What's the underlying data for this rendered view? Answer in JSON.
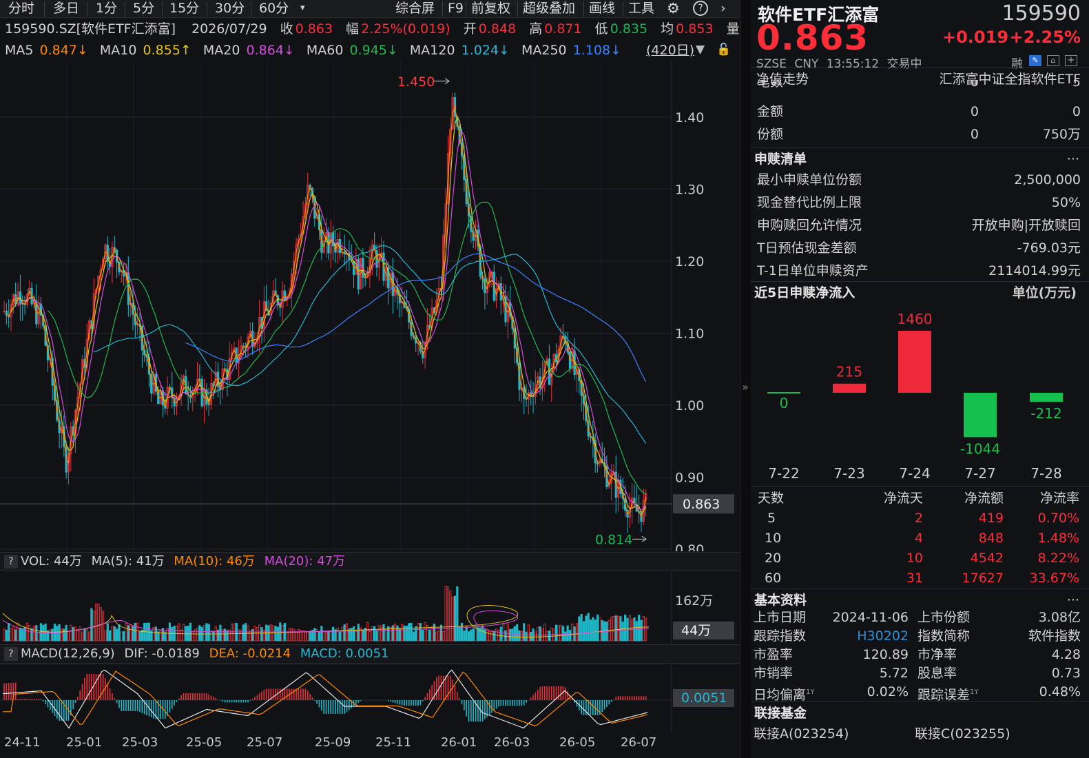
{
  "toolbar": {
    "periods": [
      "分时",
      "多日",
      "1分",
      "5分",
      "15分",
      "30分",
      "60分"
    ],
    "right": [
      "综合屏",
      "F9",
      "前复权",
      "超级叠加",
      "画线",
      "工具"
    ]
  },
  "quote": {
    "code": "159590.SZ[软件ETF汇添富]",
    "date": "2026/07/29",
    "close_label": "收",
    "close": "0.863",
    "change_label": "幅",
    "change": "2.25%(0.019)",
    "open_label": "开",
    "open": "0.848",
    "high_label": "高",
    "high": "0.871",
    "low_label": "低",
    "low": "0.835",
    "avg_label": "均",
    "avg": "0.853",
    "vol_tag": "量"
  },
  "ma": [
    {
      "label": "MA5",
      "value": "0.847↓",
      "color": "#ff8a00"
    },
    {
      "label": "MA10",
      "value": "0.855↑",
      "color": "#e3c21c"
    },
    {
      "label": "MA20",
      "value": "0.864↓",
      "color": "#d44ddb"
    },
    {
      "label": "MA60",
      "value": "0.945↓",
      "color": "#21b94e"
    },
    {
      "label": "MA120",
      "value": "1.024↓",
      "color": "#27b7d3"
    },
    {
      "label": "MA250",
      "value": "1.108↓",
      "color": "#3c83ff"
    }
  ],
  "period_range": "(420日)",
  "price_axis": {
    "ticks": [
      "1.40",
      "1.30",
      "1.20",
      "1.10",
      "1.00",
      "0.90",
      "0.80"
    ],
    "current": "0.863",
    "max_mark": "1.450",
    "min_mark": "0.814"
  },
  "volume": {
    "vol_label": "VOL: 44万",
    "ma5": "MA(5): 41万",
    "ma10": "MA(10): 46万",
    "ma20": "MA(20): 47万",
    "axis_top": "162万",
    "current": "44万"
  },
  "macd": {
    "label": "MACD(12,26,9)",
    "dif": "DIF: -0.0189",
    "dea": "DEA: -0.0214",
    "macd": "MACD: 0.0051",
    "current": "0.0051"
  },
  "x_axis": [
    "24-11",
    "25-01",
    "25-03",
    "25-05",
    "25-07",
    "25-09",
    "25-11",
    "26-01",
    "26-03",
    "26-05",
    "26-07"
  ],
  "header": {
    "name": "软件ETF汇添富",
    "code": "159590",
    "price": "0.863",
    "change": "+0.019",
    "change_pct": "+2.25%",
    "exchange": "SZSE",
    "currency": "CNY",
    "time": "13:55:12",
    "status": "交易中",
    "margin_tag": "融"
  },
  "nav": {
    "label": "净值走势",
    "index_name": "汇添富中证全指软件ETF"
  },
  "stats": [
    {
      "label": "笔数",
      "a": "0",
      "b": "5"
    },
    {
      "label": "金额",
      "a": "0",
      "b": "0"
    },
    {
      "label": "份额",
      "a": "0",
      "b": "750万"
    }
  ],
  "creation": {
    "title": "申赎清单",
    "more": "···",
    "rows": [
      {
        "label": "最小申赎单位份额",
        "value": "2,500,000"
      },
      {
        "label": "现金替代比例上限",
        "value": "50%"
      },
      {
        "label": "申购赎回允许情况",
        "value": "开放申购|开放赎回"
      },
      {
        "label": "T日预估现金差额",
        "value": "-769.03元"
      },
      {
        "label": "T-1日单位申赎资产",
        "value": "2114014.99元"
      }
    ]
  },
  "flow": {
    "title": "近5日申赎净流入",
    "unit": "单位(万元)",
    "bars": [
      {
        "date": "7-22",
        "value": 0,
        "label": "0"
      },
      {
        "date": "7-23",
        "value": 215,
        "label": "215"
      },
      {
        "date": "7-24",
        "value": 1460,
        "label": "1460"
      },
      {
        "date": "7-27",
        "value": -1044,
        "label": "-1044"
      },
      {
        "date": "7-28",
        "value": -212,
        "label": "-212"
      }
    ]
  },
  "flow_table": {
    "headers": [
      "天数",
      "净流天",
      "净流额",
      "净流率"
    ],
    "rows": [
      [
        "5",
        "2",
        "419",
        "0.70%"
      ],
      [
        "10",
        "4",
        "848",
        "1.48%"
      ],
      [
        "20",
        "10",
        "4542",
        "8.22%"
      ],
      [
        "60",
        "31",
        "17627",
        "33.67%"
      ]
    ]
  },
  "basic": {
    "title": "基本资料",
    "more": "···",
    "rows": [
      {
        "l1": "上市日期",
        "v1": "2024-11-06",
        "l2": "上市份额",
        "v2": "3.08亿"
      },
      {
        "l1": "跟踪指数",
        "v1": "H30202",
        "l2": "指数简称",
        "v2": "软件指数"
      },
      {
        "l1": "市盈率",
        "v1": "120.89",
        "l2": "市净率",
        "v2": "4.28"
      },
      {
        "l1": "市销率",
        "v1": "5.72",
        "l2": "股息率",
        "v2": "0.73"
      },
      {
        "l1": "日均偏离",
        "sup1": "1Y",
        "v1": "0.02%",
        "l2": "跟踪误差",
        "sup2": "1Y",
        "v2": "0.48%"
      }
    ]
  },
  "linked": {
    "title": "联接基金",
    "a": "联接A(023254)",
    "c": "联接C(023255)"
  },
  "chart_data": {
    "type": "line",
    "title": "159590.SZ 软件ETF汇添富 日K",
    "x": [
      "24-11",
      "25-01",
      "25-03",
      "25-05",
      "25-07",
      "25-09",
      "25-11",
      "26-01",
      "26-03",
      "26-05",
      "26-07"
    ],
    "series": [
      {
        "name": "close",
        "values": [
          1.12,
          0.92,
          1.2,
          1.01,
          1.1,
          1.25,
          1.08,
          1.42,
          1.12,
          1.08,
          0.86
        ]
      },
      {
        "name": "MA60",
        "values": [
          null,
          1.05,
          1.1,
          1.05,
          1.12,
          1.16,
          1.19,
          1.17,
          1.14,
          1.08,
          0.945
        ]
      },
      {
        "name": "MA120",
        "values": [
          null,
          null,
          null,
          1.08,
          1.05,
          1.12,
          1.16,
          1.19,
          1.17,
          1.12,
          1.024
        ]
      },
      {
        "name": "MA250",
        "values": [
          null,
          null,
          null,
          null,
          null,
          null,
          1.1,
          1.13,
          1.15,
          1.14,
          1.108
        ]
      }
    ],
    "ylim": [
      0.8,
      1.45
    ],
    "max": 1.45,
    "min": 0.814
  }
}
